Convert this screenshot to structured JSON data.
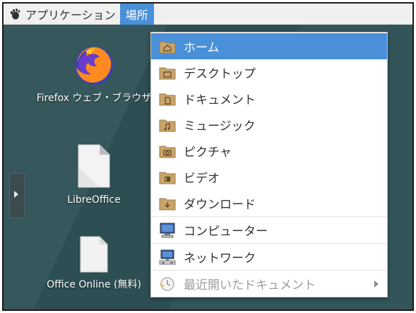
{
  "topbar": {
    "applications_label": "アプリケーション",
    "places_label": "場所"
  },
  "desktop": {
    "icons": [
      {
        "label": "Firefox ウェブ・ブラウザ",
        "icon": "firefox-icon"
      },
      {
        "label": "LibreOffice",
        "icon": "libreoffice-icon"
      },
      {
        "label": "Office Online (無料)",
        "icon": "document-icon"
      }
    ]
  },
  "places_menu": {
    "items": [
      {
        "label": "ホーム",
        "icon": "folder-home-icon"
      },
      {
        "label": "デスクトップ",
        "icon": "folder-desktop-icon"
      },
      {
        "label": "ドキュメント",
        "icon": "folder-documents-icon"
      },
      {
        "label": "ミュージック",
        "icon": "folder-music-icon"
      },
      {
        "label": "ピクチャ",
        "icon": "folder-pictures-icon"
      },
      {
        "label": "ビデオ",
        "icon": "folder-videos-icon"
      },
      {
        "label": "ダウンロード",
        "icon": "folder-download-icon"
      },
      {
        "label": "コンピューター",
        "icon": "computer-icon"
      },
      {
        "label": "ネットワーク",
        "icon": "network-icon"
      },
      {
        "label": "最近開いたドキュメント",
        "icon": "recent-clock-icon"
      }
    ]
  },
  "colors": {
    "accent": "#4a90d9",
    "desktop": "#2f5256",
    "folder": "#c9a46a"
  }
}
